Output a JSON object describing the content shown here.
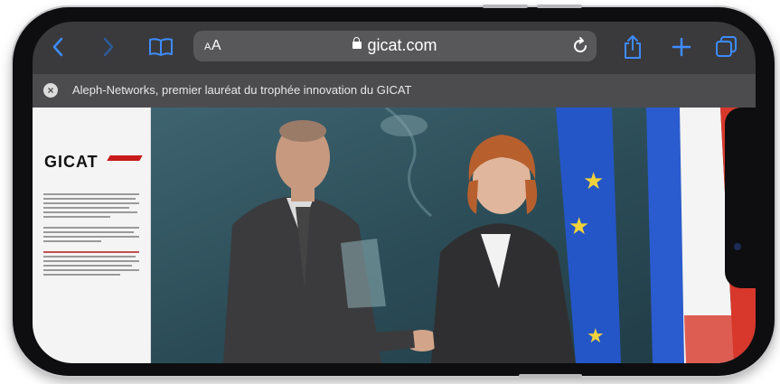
{
  "browser": {
    "text_size_label": "AA",
    "url": "gicat.com",
    "tab_title": "Aleph-Networks, premier lauréat du trophée innovation du GICAT"
  },
  "page": {
    "logo_text": "GICAT"
  },
  "colors": {
    "accent": "#3d8cff",
    "toolbar": "#3a3a3c",
    "tabbar": "#4c4c4f",
    "logo_red": "#c81a1a"
  },
  "icons": [
    "back-icon",
    "forward-icon",
    "bookmarks-icon",
    "lock-icon",
    "reload-icon",
    "share-icon",
    "new-tab-icon",
    "tabs-icon",
    "close-tab-icon"
  ]
}
